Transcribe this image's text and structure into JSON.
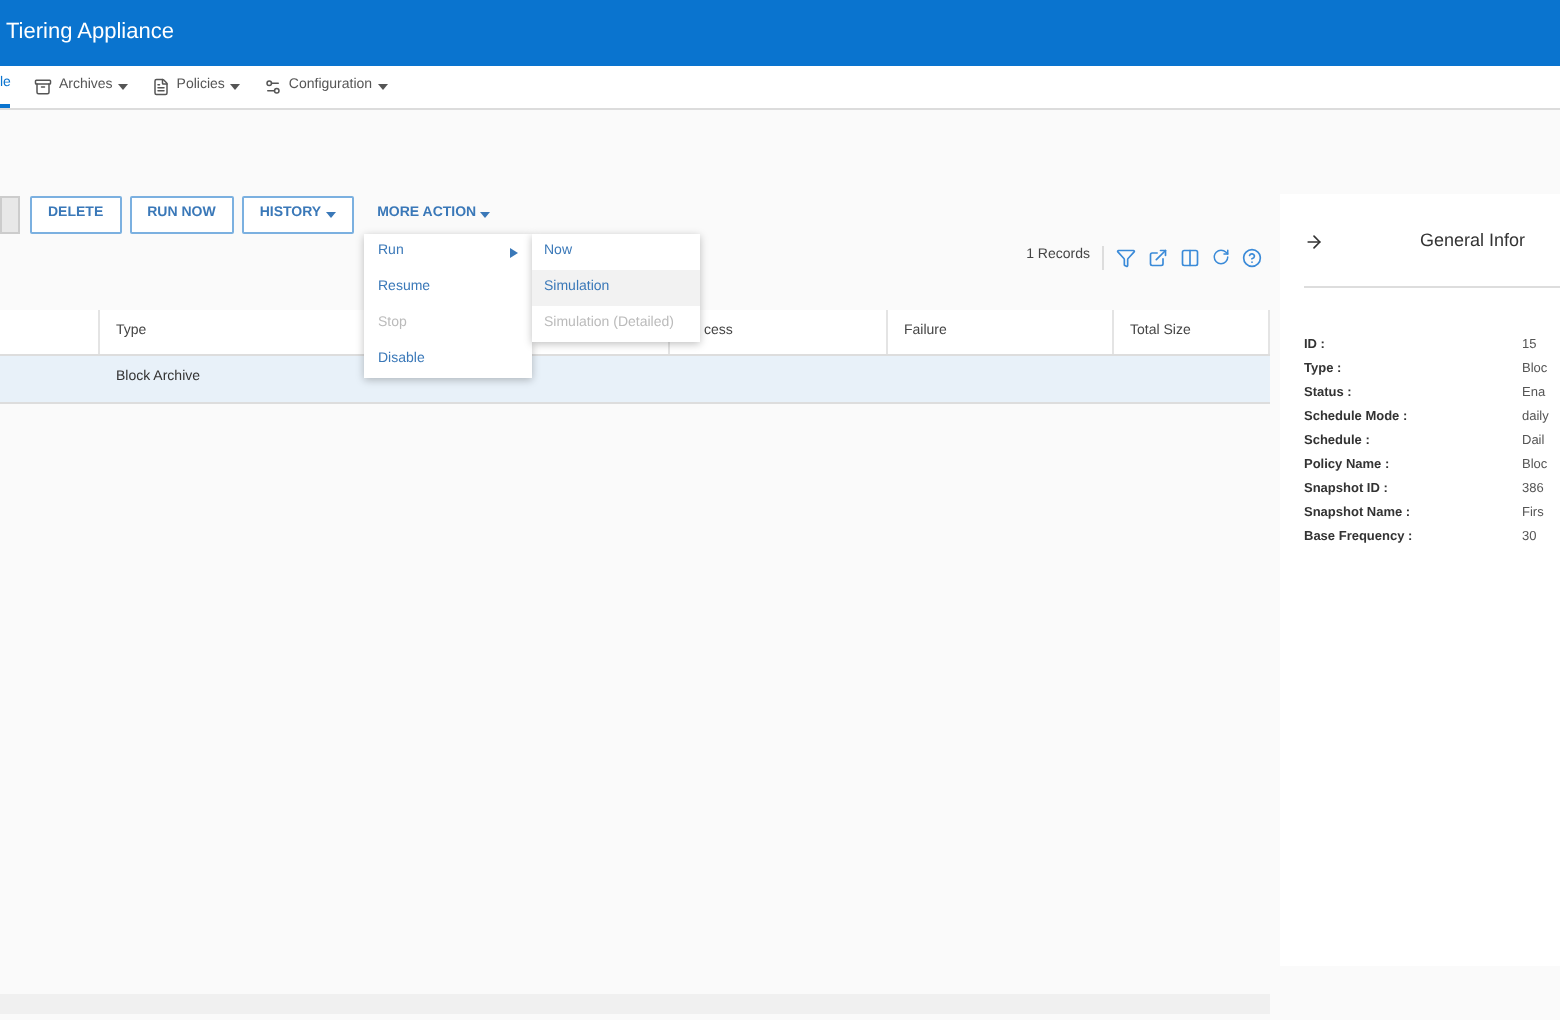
{
  "app_title": "Tiering Appliance",
  "nav": [
    {
      "label": "le",
      "selected": true,
      "kind": "plain"
    },
    {
      "label": "Archives",
      "selected": false,
      "kind": "dropdown"
    },
    {
      "label": "Policies",
      "selected": false,
      "kind": "dropdown"
    },
    {
      "label": "Configuration",
      "selected": false,
      "kind": "dropdown"
    }
  ],
  "toolbar": {
    "buttons": [
      {
        "label": "DELETE",
        "kind": "outline"
      },
      {
        "label": "RUN NOW",
        "kind": "outline"
      },
      {
        "label": "HISTORY",
        "kind": "dropdown"
      },
      {
        "label": "MORE ACTION",
        "kind": "menu"
      }
    ],
    "records": "1 Records"
  },
  "menu": [
    {
      "label": "Run",
      "disabled": false,
      "submenu": true
    },
    {
      "label": "Resume",
      "disabled": false,
      "submenu": false
    },
    {
      "label": "Stop",
      "disabled": true,
      "submenu": false
    },
    {
      "label": "Disable",
      "disabled": false,
      "submenu": false
    }
  ],
  "submenu": [
    {
      "label": "Now",
      "disabled": false,
      "selected": false
    },
    {
      "label": "Simulation",
      "disabled": false,
      "selected": true
    },
    {
      "label": "Simulation (Detailed)",
      "disabled": true,
      "selected": false
    }
  ],
  "table": {
    "columns": [
      "",
      "Type",
      "cess",
      "Failure",
      "Total Size"
    ],
    "rows": [
      {
        "selected": true,
        "cells": [
          "",
          "Block Archive",
          "",
          "",
          ""
        ]
      }
    ]
  },
  "panel": {
    "title": "General Infor",
    "fields": [
      {
        "label": "ID :",
        "value": "15"
      },
      {
        "label": "Type :",
        "value": "Bloc"
      },
      {
        "label": "Status :",
        "value": "Ena"
      },
      {
        "label": "Schedule Mode :",
        "value": "daily"
      },
      {
        "label": "Schedule :",
        "value": "Dail"
      },
      {
        "label": "Policy Name :",
        "value": "Bloc"
      },
      {
        "label": "Snapshot ID :",
        "value": "386"
      },
      {
        "label": "Snapshot Name :",
        "value": "Firs"
      },
      {
        "label": "Base Frequency :",
        "value": "30"
      }
    ]
  }
}
